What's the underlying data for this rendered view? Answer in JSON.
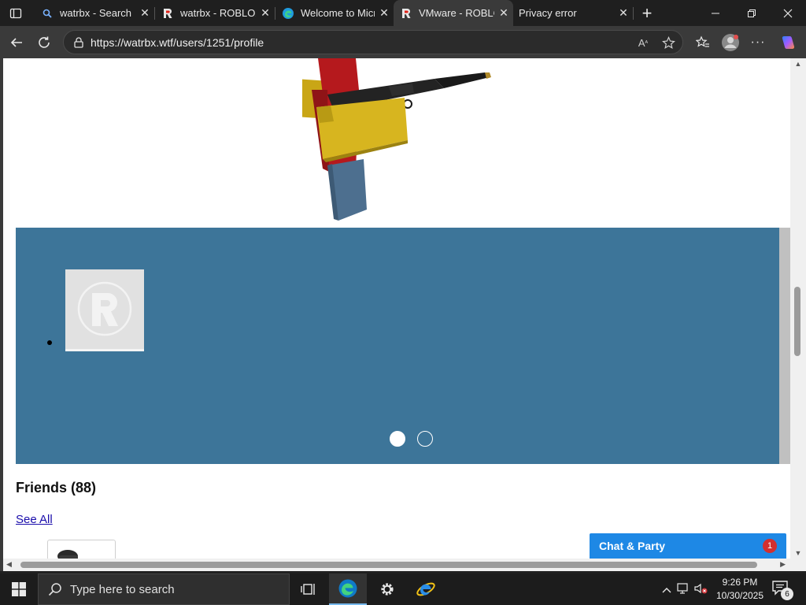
{
  "browser": {
    "tabs": [
      {
        "label": "watrbx - Search",
        "icon": "search-icon",
        "active": false
      },
      {
        "label": "watrbx - ROBLOX",
        "icon": "roblox-icon",
        "active": false
      },
      {
        "label": "Welcome to Micr",
        "icon": "edge-icon",
        "active": false
      },
      {
        "label": "VMware - ROBLO",
        "icon": "roblox-icon",
        "active": true
      },
      {
        "label": "Privacy error",
        "icon": "",
        "active": false
      }
    ],
    "url": "https://watrbx.wtf/users/1251/profile"
  },
  "page": {
    "carousel": {
      "slide_count": 2,
      "active_slide": 1
    },
    "friends_heading": "Friends (88)",
    "see_all": "See All",
    "chat": {
      "label": "Chat & Party",
      "badge": "1"
    }
  },
  "taskbar": {
    "search_placeholder": "Type here to search",
    "time": "9:26 PM",
    "date": "10/30/2025",
    "notification_count": "6"
  },
  "colors": {
    "carousel_bg": "#3d7599",
    "chat_bar": "#1e88e5",
    "chat_badge": "#d32f2f",
    "link": "#1a0dab"
  }
}
